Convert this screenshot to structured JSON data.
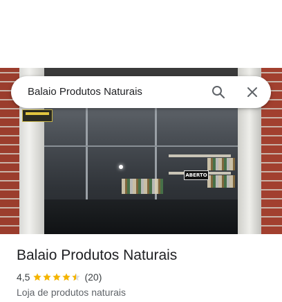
{
  "search": {
    "query": "Balaio Produtos Naturais",
    "search_icon": "search-icon",
    "close_icon": "close-icon"
  },
  "photo": {
    "open_sign": "ABERTO",
    "description_icon": "storefront-photo"
  },
  "place": {
    "name": "Balaio Produtos Naturais",
    "rating": "4,5",
    "rating_value": 4.5,
    "stars_max": 5,
    "reviews": "(20)",
    "category": "Loja de produtos naturais"
  },
  "colors": {
    "star": "#f4b400",
    "star_empty": "#dadce0",
    "icon": "#5f6368",
    "text": "#202124"
  }
}
